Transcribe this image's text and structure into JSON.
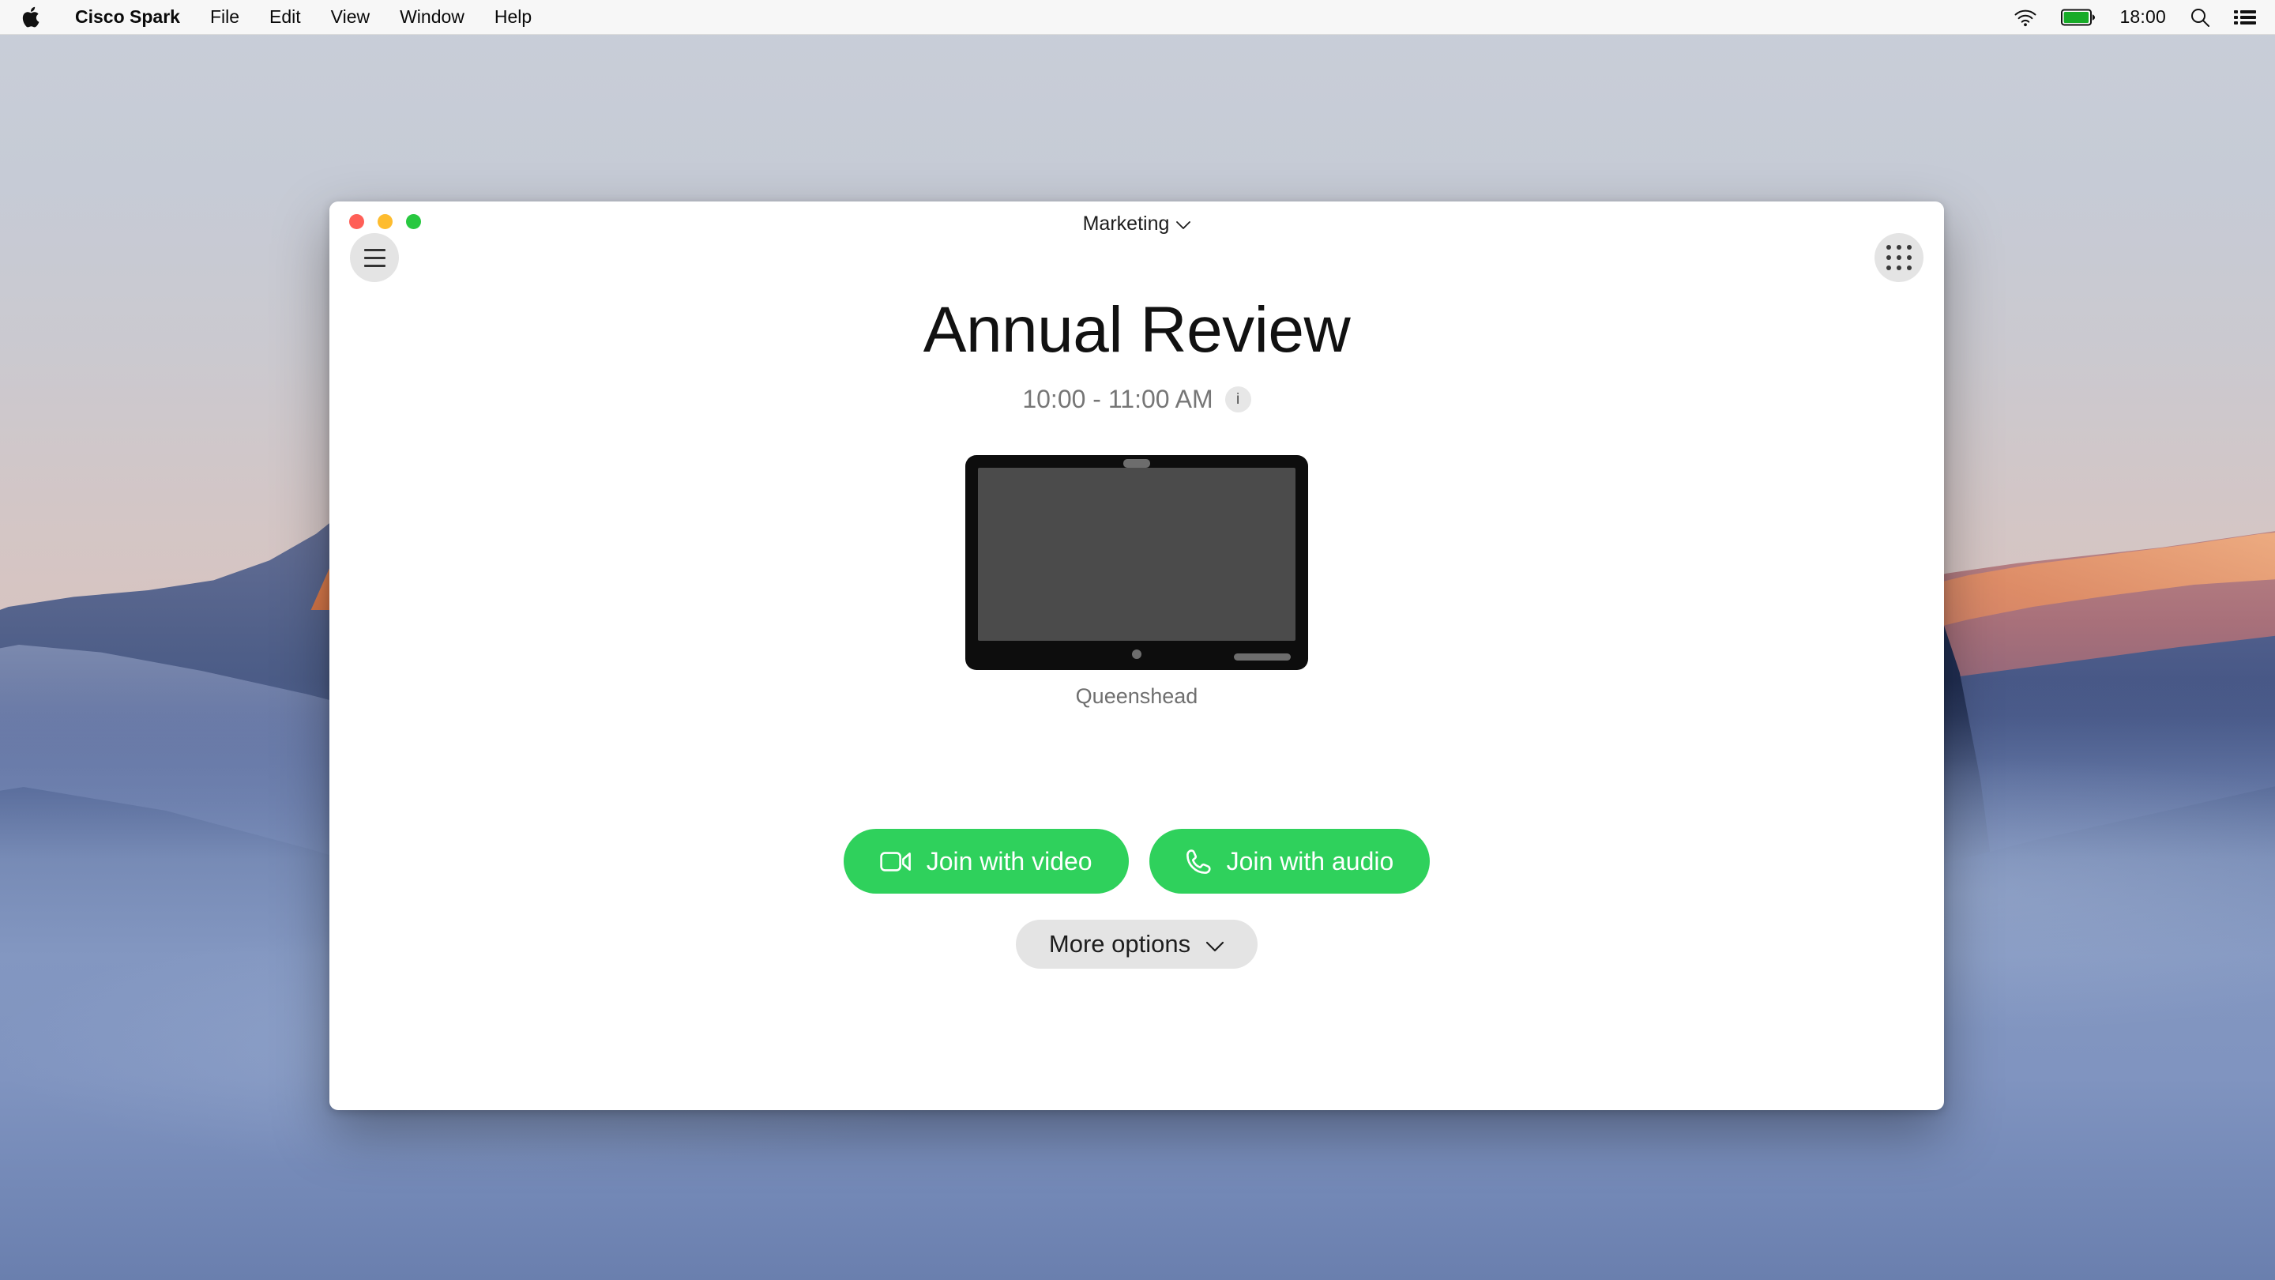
{
  "menubar": {
    "apple_logo": "apple-logo",
    "app_name": "Cisco Spark",
    "menus": [
      "File",
      "Edit",
      "View",
      "Window",
      "Help"
    ],
    "status": {
      "wifi_icon": "wifi-icon",
      "battery_icon": "battery-icon",
      "battery_color": "#17ab28",
      "clock": "18:00",
      "search_icon": "search-icon",
      "control_center_icon": "control-center-icon"
    }
  },
  "window": {
    "traffic_lights": {
      "close": "close-window-button",
      "minimize": "minimize-window-button",
      "zoom": "zoom-window-button",
      "close_color": "#ff5f57",
      "minimize_color": "#febc2e",
      "zoom_color": "#28c840"
    },
    "title": "Marketing",
    "title_chevron": "chevron-down-icon",
    "menu_button": "hamburger-menu-button",
    "grid_button": "app-grid-button"
  },
  "meeting": {
    "title": "Annual Review",
    "time": "10:00 - 11:00 AM",
    "info_label": "i"
  },
  "device": {
    "name": "Queenshead",
    "screen_color": "#4b4b4b",
    "bezel_color": "#0d0d0d"
  },
  "actions": {
    "accent_color": "#2fd15c",
    "join_video": {
      "label": "Join with video",
      "icon": "video-camera-icon"
    },
    "join_audio": {
      "label": "Join with audio",
      "icon": "phone-handset-icon"
    },
    "more_options": {
      "label": "More options",
      "icon": "chevron-down-icon"
    }
  }
}
